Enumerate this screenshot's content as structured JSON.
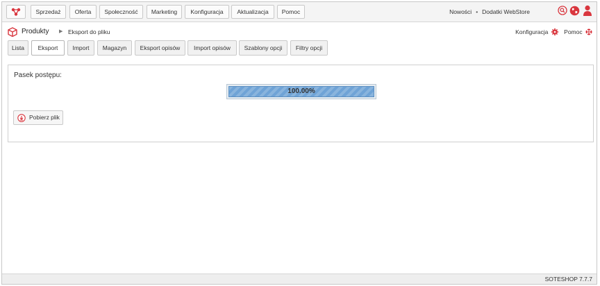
{
  "topnav": {
    "items": [
      "Sprzedaż",
      "Oferta",
      "Społeczność",
      "Marketing",
      "Konfiguracja",
      "Aktualizacja",
      "Pomoc"
    ],
    "news_link": "Nowości",
    "separator": "•",
    "webstore_link": "Dodatki WebStore",
    "icons": [
      "search-icon",
      "globe-icon",
      "user-icon"
    ]
  },
  "breadcrumb": {
    "main": "Produkty",
    "arrow": "▶",
    "current": "Eksport do pliku"
  },
  "header_links": {
    "config": "Konfiguracja",
    "help": "Pomoc"
  },
  "tabs": {
    "items": [
      "Lista",
      "Eksport",
      "Import",
      "Magazyn",
      "Eksport opisów",
      "Import opisów",
      "Szablony opcji",
      "Filtry opcji"
    ],
    "active": "Eksport"
  },
  "panel": {
    "label": "Pasek postępu:",
    "progress_text": "100.00%",
    "progress_fraction": 1.0,
    "download_label": "Pobierz plik"
  },
  "footer": {
    "version": "SOTESHOP 7.7.7"
  },
  "colors": {
    "accent": "#d9363e",
    "progress_fill": "#6fa3d6"
  }
}
